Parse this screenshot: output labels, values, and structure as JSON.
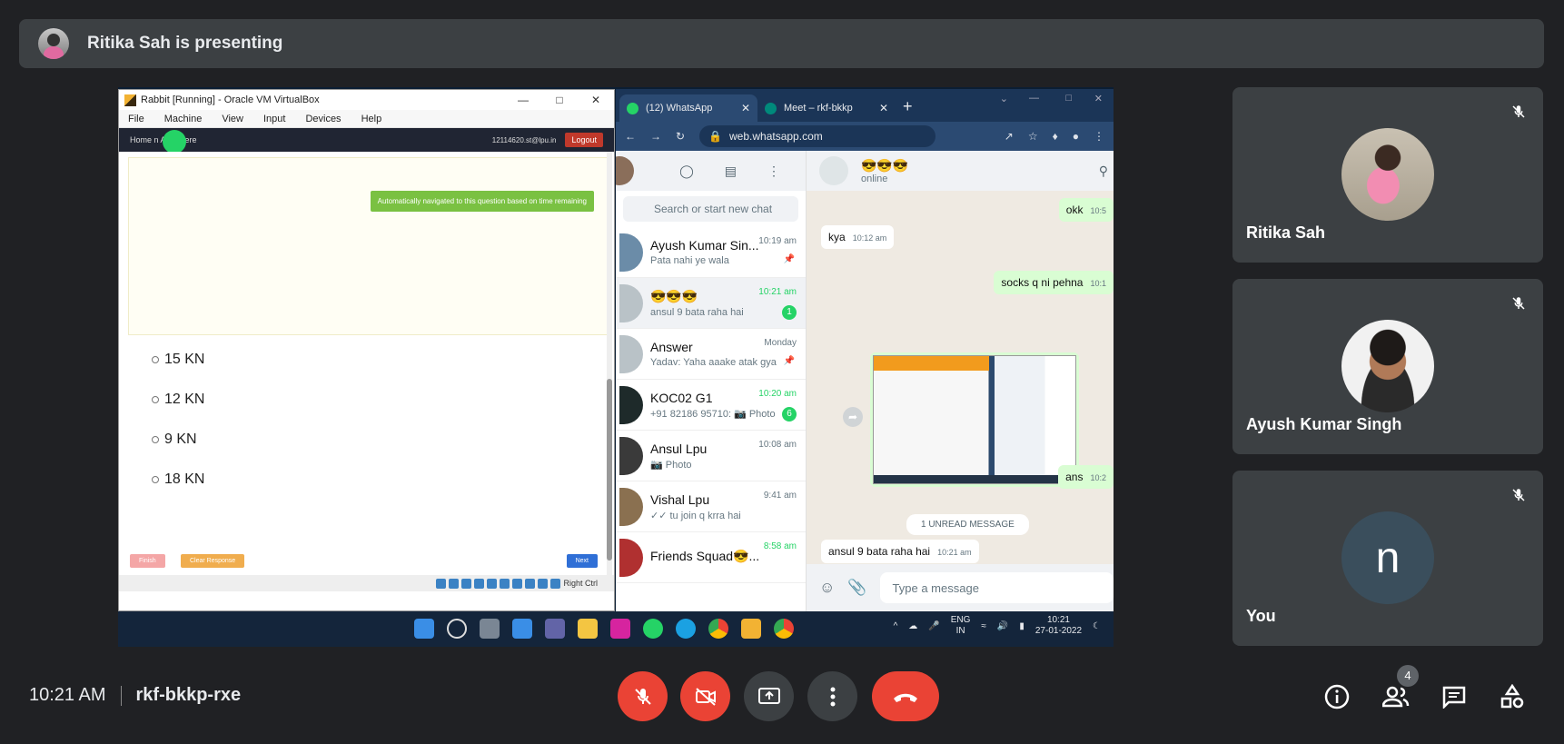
{
  "banner": {
    "text": "Ritika Sah is presenting"
  },
  "vbox": {
    "title": "Rabbit [Running] - Oracle VM VirtualBox",
    "menu": [
      "File",
      "Machine",
      "View",
      "Input",
      "Devices",
      "Help"
    ],
    "guest_home": "Home      n Anywhere",
    "guest_email": "12114620.st@lpu.in",
    "guest_logout": "Logout",
    "auto_note": "Automatically navigated to this question based on time remaining",
    "options": [
      "15 KN",
      "12 KN",
      "9 KN",
      "18 KN"
    ],
    "finish_label": "Finish",
    "clear_label": "Clear Response",
    "next_label": "Next",
    "host_key": "Right Ctrl"
  },
  "browser": {
    "tabs": [
      {
        "label": "(12) WhatsApp",
        "active": true
      },
      {
        "label": "Meet – rkf-bkkp",
        "active": false
      }
    ],
    "url": "web.whatsapp.com"
  },
  "whatsapp": {
    "search_placeholder": "Search or start new chat",
    "chats": [
      {
        "name": "Ayush Kumar Sin...",
        "last": "Pata nahi ye wala",
        "time": "10:19 am",
        "pinned": true
      },
      {
        "name": "😎😎😎",
        "last": "ansul 9 bata raha hai",
        "time": "10:21 am",
        "badge": "1",
        "selected": true
      },
      {
        "name": "Answer",
        "last": "Yadav: Yaha aaake atak gya",
        "time": "Monday",
        "pinned": true
      },
      {
        "name": "KOC02 G1",
        "last": "+91 82186 95710: 📷 Photo",
        "time": "10:20 am",
        "badge": "6"
      },
      {
        "name": "Ansul Lpu",
        "last": "📷 Photo",
        "time": "10:08 am"
      },
      {
        "name": "Vishal Lpu",
        "last": "✓✓ tu join q krra hai",
        "time": "9:41 am"
      },
      {
        "name": "Friends Squad😎...",
        "last": "",
        "time": "8:58 am"
      }
    ],
    "conversation": {
      "name": "😎😎😎",
      "status": "online",
      "messages": [
        {
          "text": "okk",
          "time": "10:5",
          "dir": "out"
        },
        {
          "text": "kya",
          "time": "10:12 am",
          "dir": "in"
        },
        {
          "text": "socks q ni pehna",
          "time": "10:1",
          "dir": "out"
        },
        {
          "text": "ans",
          "time": "10:2",
          "dir": "out"
        },
        {
          "text": "ansul 9 bata raha hai",
          "time": "10:21 am",
          "dir": "in"
        }
      ],
      "unread": "1 UNREAD MESSAGE",
      "composer_placeholder": "Type a message"
    }
  },
  "taskbar": {
    "lang": "ENG",
    "region": "IN",
    "time": "10:21",
    "date": "27-01-2022"
  },
  "participants": [
    {
      "name": "Ritika Sah"
    },
    {
      "name": "Ayush Kumar Singh"
    },
    {
      "name": "You",
      "initial": "n"
    }
  ],
  "meeting": {
    "time": "10:21 AM",
    "code": "rkf-bkkp-rxe",
    "people_count": "4"
  },
  "colors": {
    "background": "#202124",
    "tile": "#3c4043",
    "red": "#ea4335",
    "avatar_you": "#3a4e5c"
  }
}
